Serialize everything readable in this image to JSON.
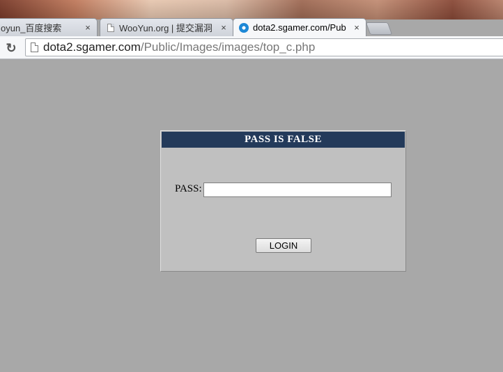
{
  "browser": {
    "tabs": [
      {
        "title": "oyun_百度搜索",
        "close": "×"
      },
      {
        "title": "WooYun.org | 提交漏洞",
        "close": "×"
      },
      {
        "title": "dota2.sgamer.com/Pub",
        "close": "×",
        "active": true
      }
    ],
    "address_bar": {
      "host": "dota2.sgamer.com",
      "path": "/Public/Images/images/top_c.php"
    },
    "reload_icon": "↻"
  },
  "login": {
    "header": "PASS IS FALSE",
    "pass_label": "PASS:",
    "pass_value": "",
    "button_label": "LOGIN"
  },
  "colors": {
    "page_background": "#a8a8a8",
    "panel_background": "#c0c0c0",
    "header_background": "#233a5a"
  }
}
